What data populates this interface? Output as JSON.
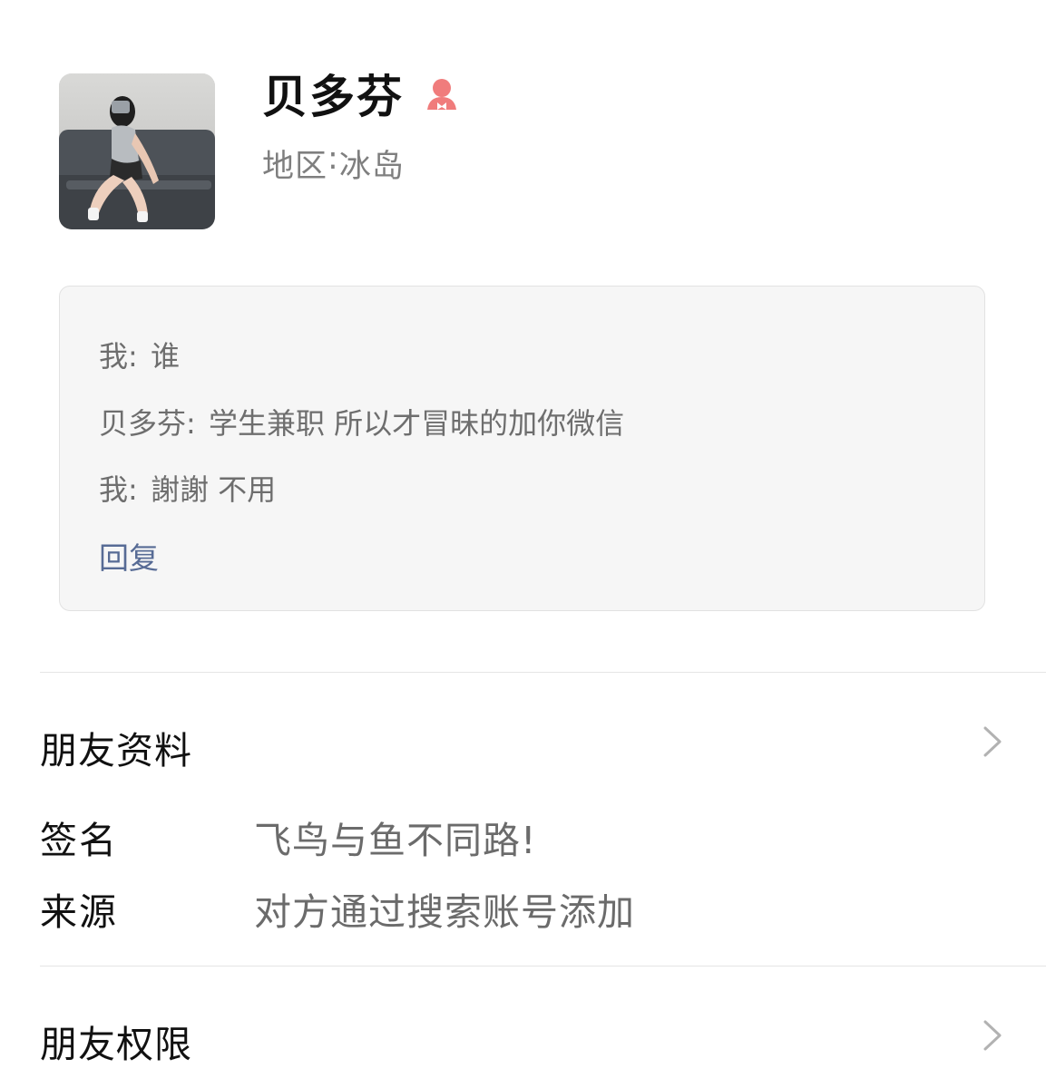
{
  "profile": {
    "name": "贝多芬",
    "gender_icon": "female-icon",
    "region_label": "地区",
    "region_separator": ":",
    "region_value": "冰岛"
  },
  "greeting": {
    "messages": [
      {
        "sender": "我:",
        "text": "谁"
      },
      {
        "sender": "贝多芬:",
        "text": "学生兼职 所以才冒昧的加你微信"
      },
      {
        "sender": "我:",
        "text": "謝謝 不用"
      }
    ],
    "reply_label": "回复"
  },
  "friend_info": {
    "title": "朋友资料",
    "signature_label": "签名",
    "signature_value": "飞鸟与鱼不同路!",
    "source_label": "来源",
    "source_value": "对方通过搜索账号添加"
  },
  "friend_permissions": {
    "title": "朋友权限"
  },
  "colors": {
    "link": "#576b95",
    "female_icon": "#f07c7c",
    "muted_text": "#6e6e6e",
    "box_bg": "#f6f6f6"
  }
}
